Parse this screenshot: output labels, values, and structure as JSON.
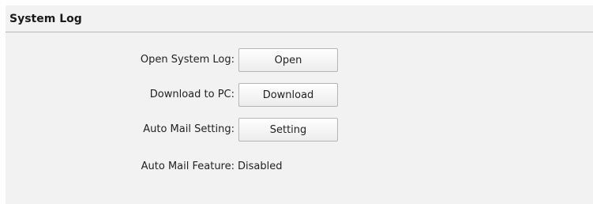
{
  "section": {
    "title": "System Log"
  },
  "rows": [
    {
      "label": "Open System Log:",
      "button_label": "Open"
    },
    {
      "label": "Download to PC:",
      "button_label": "Download"
    },
    {
      "label": "Auto Mail Setting:",
      "button_label": "Setting"
    }
  ],
  "auto_mail_feature": {
    "label": "Auto Mail Feature:",
    "value": "Disabled"
  }
}
